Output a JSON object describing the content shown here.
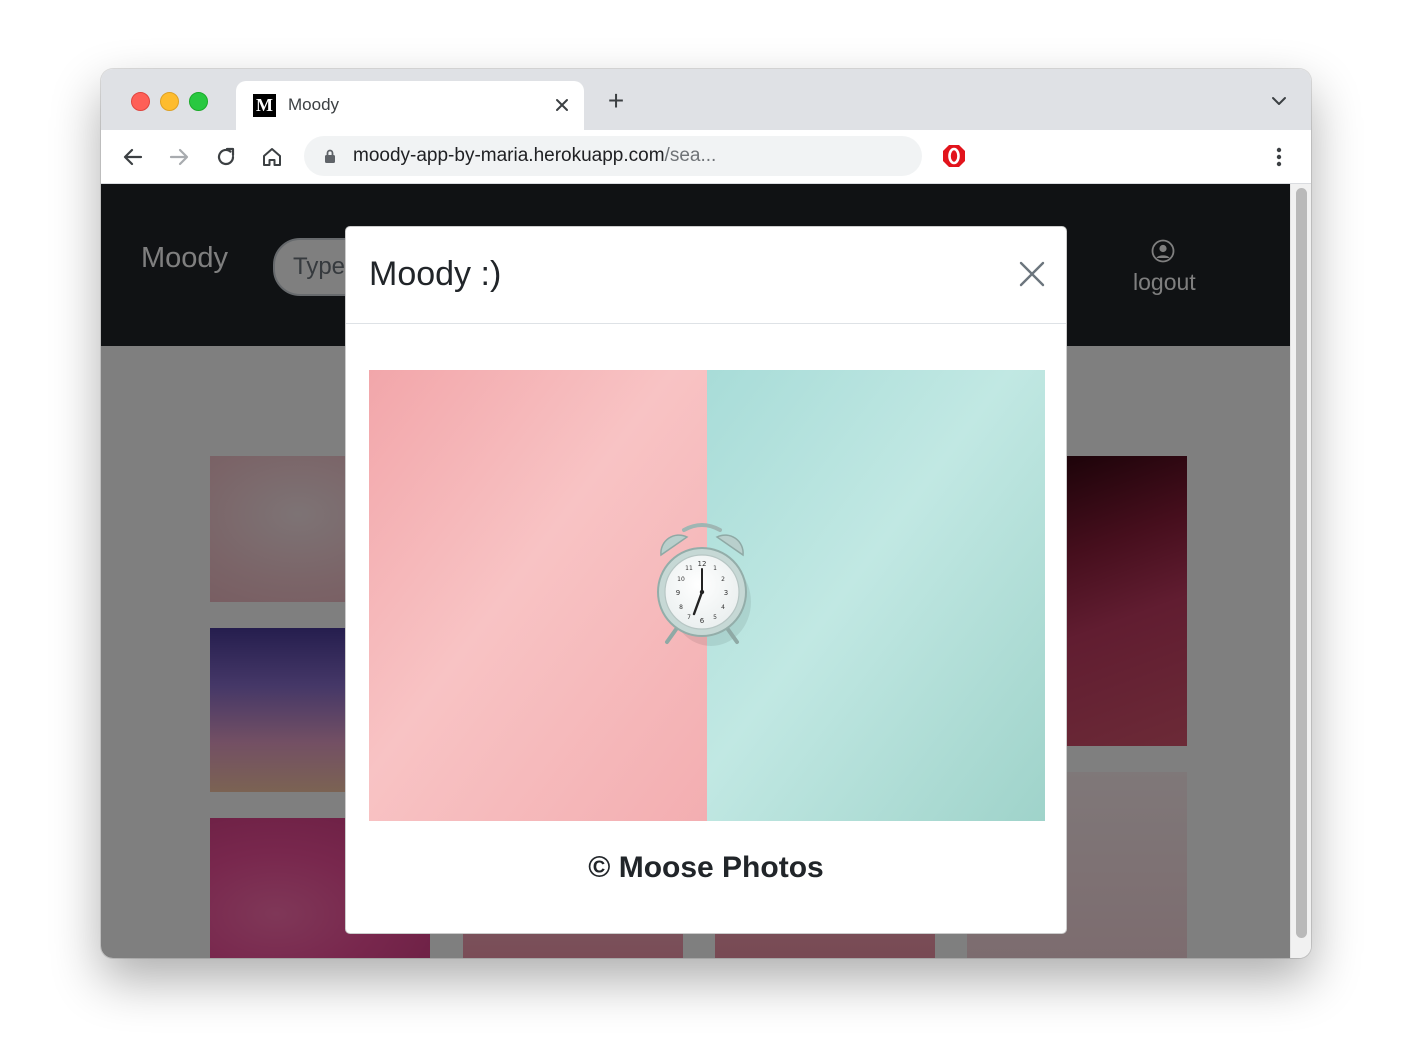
{
  "browser": {
    "tab": {
      "favicon_letter": "M",
      "title": "Moody"
    },
    "new_tab_symbol": "+",
    "address": {
      "host": "moody-app-by-maria.herokuapp.com",
      "path": "/sea..."
    },
    "colors": {
      "traffic_red": "#fe5f57",
      "traffic_yellow": "#febc2e",
      "traffic_green": "#28c840",
      "extension_red": "#e2141c"
    }
  },
  "app": {
    "brand": "Moody",
    "search": {
      "placeholder": "Type"
    },
    "account": {
      "label": "logout",
      "icon": "user-circle-icon"
    },
    "colors": {
      "navbar": "#212529"
    }
  },
  "modal": {
    "title": "Moody :)",
    "close_icon": "close-icon",
    "photo": {
      "subject": "alarm-clock",
      "left_color": "#f7b7b9",
      "right_color": "#b5e2dc"
    },
    "credit": "© Moose Photos"
  }
}
